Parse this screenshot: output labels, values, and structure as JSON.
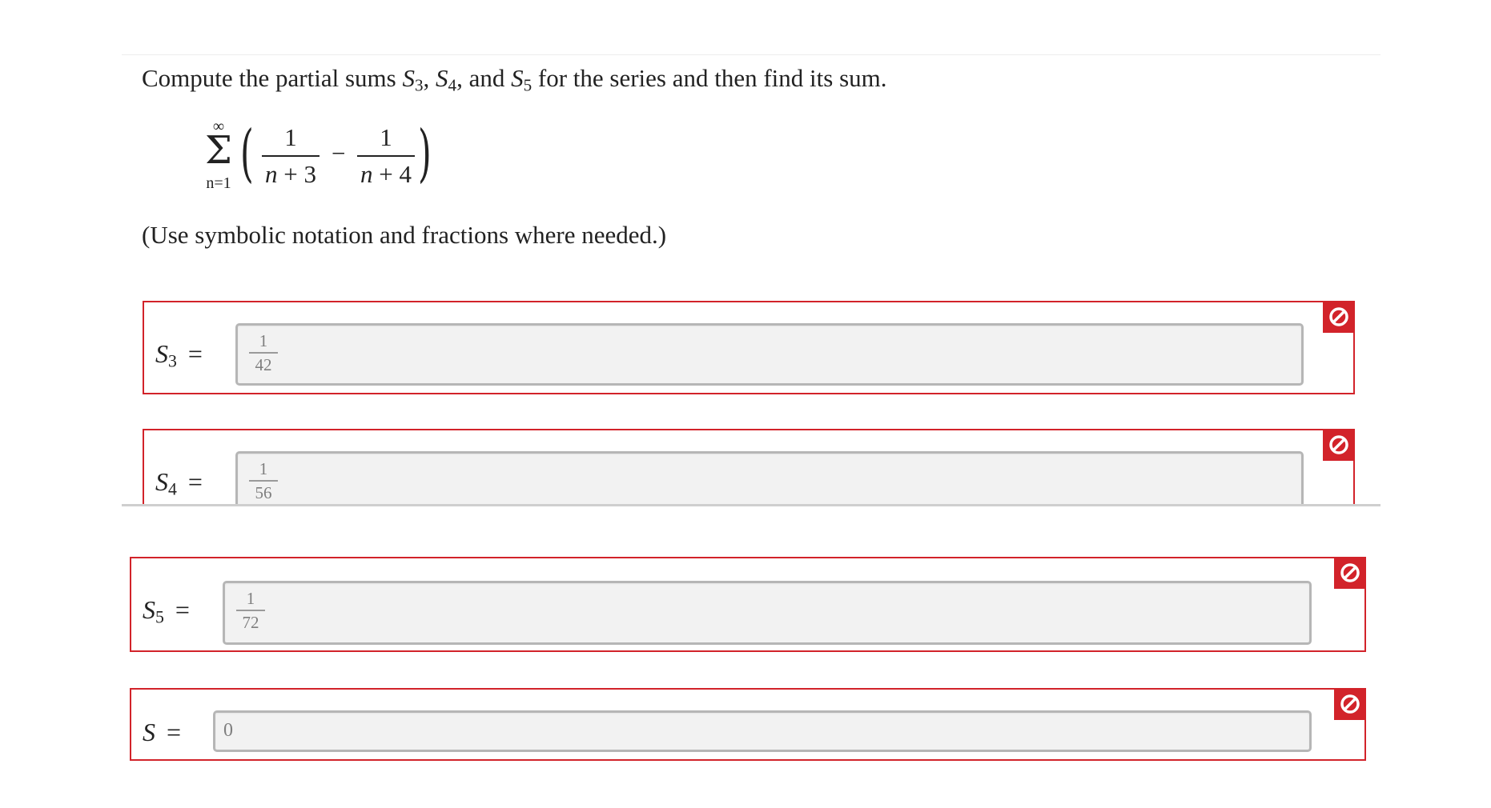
{
  "question": {
    "prefix": "Compute the partial sums ",
    "s3": "S",
    "s3_sub": "3",
    "sep1": ", ",
    "s4": "S",
    "s4_sub": "4",
    "sep2": ", and ",
    "s5": "S",
    "s5_sub": "5",
    "suffix": " for the series and then find its sum."
  },
  "formula": {
    "upper_limit": "∞",
    "sigma": "Σ",
    "lower_limit": "n=1",
    "left_paren": "(",
    "right_paren": ")",
    "frac1_num": "1",
    "frac1_den_var": "n",
    "frac1_den_rest": " + 3",
    "minus": "−",
    "frac2_num": "1",
    "frac2_den_var": "n",
    "frac2_den_rest": " + 4"
  },
  "note": "(Use symbolic notation and fractions where needed.)",
  "answers": [
    {
      "symbol": "S",
      "sub": "3",
      "equals": "=",
      "num": "1",
      "den": "42"
    },
    {
      "symbol": "S",
      "sub": "4",
      "equals": "=",
      "num": "1",
      "den": "56"
    },
    {
      "symbol": "S",
      "sub": "5",
      "equals": "=",
      "num": "1",
      "den": "72"
    },
    {
      "symbol": "S",
      "sub": "",
      "equals": "=",
      "value": "0"
    }
  ],
  "colors": {
    "error": "#d2232a",
    "input_bg": "#f2f2f2",
    "input_border": "#b6b6b6"
  },
  "icons": {
    "status": "incorrect-icon"
  }
}
